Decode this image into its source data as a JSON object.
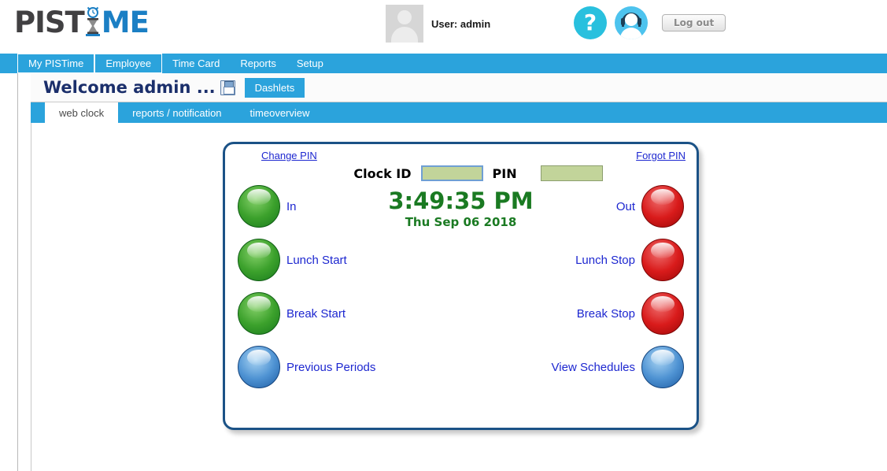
{
  "header": {
    "logo_dark": "PIST",
    "logo_blue": "ME",
    "user_label": "User: admin",
    "help_icon_glyph": "?",
    "logout_label": "Log out"
  },
  "mainnav": {
    "items": [
      {
        "label": "My PISTime",
        "boxed": true
      },
      {
        "label": "Employee",
        "boxed": true
      },
      {
        "label": "Time Card",
        "boxed": false
      },
      {
        "label": "Reports",
        "boxed": false
      },
      {
        "label": "Setup",
        "boxed": false
      }
    ]
  },
  "welcome": {
    "title": "Welcome admin ...",
    "dashlets_label": "Dashlets"
  },
  "tabs": [
    {
      "label": "web clock",
      "active": true
    },
    {
      "label": "reports / notification",
      "active": false
    },
    {
      "label": "timeoverview",
      "active": false
    }
  ],
  "panel": {
    "change_pin_label": "Change PIN",
    "forgot_pin_label": "Forgot PIN",
    "clock_id_label": "Clock ID",
    "clock_id_value": "",
    "clock_id_placeholder": "",
    "pin_label": "PIN",
    "pin_value": "",
    "pin_placeholder": "",
    "time": "3:49:35 PM",
    "date": "Thu Sep 06 2018",
    "rows": [
      {
        "left_label": "In",
        "left_color": "green",
        "right_label": "Out",
        "right_color": "red"
      },
      {
        "left_label": "Lunch Start",
        "left_color": "green",
        "right_label": "Lunch Stop",
        "right_color": "red"
      },
      {
        "left_label": "Break Start",
        "left_color": "green",
        "right_label": "Break Stop",
        "right_color": "red"
      },
      {
        "left_label": "Previous Periods",
        "left_color": "blue",
        "right_label": "View Schedules",
        "right_color": "blue"
      }
    ]
  },
  "colors": {
    "nav_blue": "#2ba3dc",
    "help_cyan": "#29c0de",
    "support_blue": "#4dc3ee",
    "panel_border": "#1b5286",
    "clock_green": "#1a7a22",
    "link_blue": "#1d27d0",
    "welcome_navy": "#1b2f6b",
    "input_green": "#c2d49a"
  }
}
